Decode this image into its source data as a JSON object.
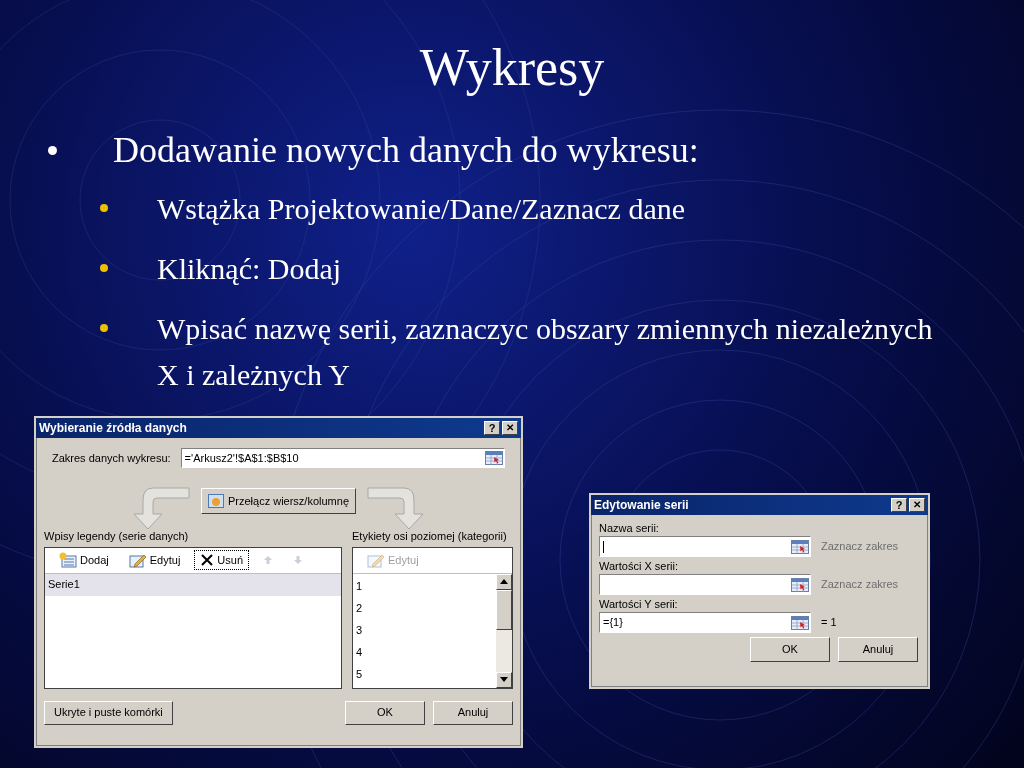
{
  "slide": {
    "title": "Wykresy",
    "bullets": [
      {
        "text": "Dodawanie nowych danych do wykresu:",
        "children": [
          {
            "text": "Wstążka Projektowanie/Dane/Zaznacz dane"
          },
          {
            "text": "Kliknąć: Dodaj"
          },
          {
            "text": "Wpisać nazwę serii, zaznaczyc obszary zmiennych niezależnych X i zależnych Y"
          }
        ]
      }
    ]
  },
  "source_dialog": {
    "title": "Wybieranie źródła danych",
    "help": "?",
    "close": "✕",
    "range_label": "Zakres danych wykresu:",
    "range_value": "='Arkusz2'!$A$1:$B$10",
    "switch_button": "Przełącz wiersz/kolumnę",
    "legend_label": "Wpisy legendy (serie danych)",
    "legend_toolbar": [
      {
        "kind": "add",
        "label": "Dodaj",
        "disabled": false,
        "focused": false
      },
      {
        "kind": "edit",
        "label": "Edytuj",
        "disabled": false,
        "focused": false
      },
      {
        "kind": "remove",
        "label": "Usuń",
        "disabled": false,
        "focused": true
      },
      {
        "kind": "up",
        "disabled": true,
        "focused": false
      },
      {
        "kind": "down",
        "disabled": true,
        "focused": false
      }
    ],
    "legend_items": [
      {
        "label": "Serie1",
        "selected": true
      }
    ],
    "axis_label": "Etykiety osi poziomej (kategorii)",
    "axis_toolbar": [
      {
        "kind": "edit",
        "label": "Edytuj",
        "disabled": true,
        "focused": false
      }
    ],
    "axis_items": [
      "1",
      "2",
      "3",
      "4",
      "5"
    ],
    "hidden_button": "Ukryte i puste komórki",
    "ok": "OK",
    "cancel": "Anuluj"
  },
  "series_dialog": {
    "title": "Edytowanie serii",
    "help": "?",
    "close": "✕",
    "fields": [
      {
        "label": "Nazwa serii:",
        "focused": true,
        "preview": "Zaznacz zakres",
        "preview_disabled": true
      },
      {
        "label": "Wartości X serii:",
        "focused": false,
        "preview": "Zaznacz zakres",
        "preview_disabled": true
      },
      {
        "label": "Wartości Y serii:",
        "value": "={1}",
        "focused": false,
        "preview": "= 1",
        "preview_disabled": false
      }
    ],
    "ok": "OK",
    "cancel": "Anuluj"
  }
}
